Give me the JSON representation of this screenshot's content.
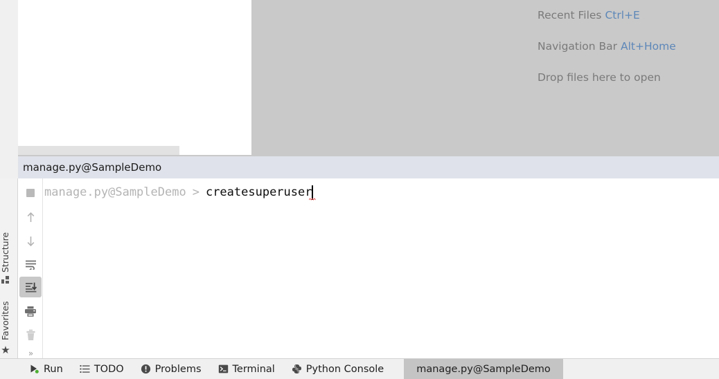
{
  "editor": {
    "hints": [
      {
        "label": "Recent Files",
        "shortcut": "Ctrl+E"
      },
      {
        "label": "Navigation Bar",
        "shortcut": "Alt+Home"
      },
      {
        "label": "Drop files here to open",
        "shortcut": ""
      }
    ]
  },
  "tool_window": {
    "title": "manage.py@SampleDemo",
    "toolbar": [
      {
        "name": "stop-button",
        "tooltip": "Stop"
      },
      {
        "name": "up-button",
        "tooltip": "Up"
      },
      {
        "name": "down-button",
        "tooltip": "Down"
      },
      {
        "name": "soft-wrap-button",
        "tooltip": "Soft-Wrap"
      },
      {
        "name": "scroll-to-end-button",
        "tooltip": "Scroll to the end"
      },
      {
        "name": "print-button",
        "tooltip": "Print"
      },
      {
        "name": "clear-all-button",
        "tooltip": "Clear All"
      },
      {
        "name": "more-button",
        "label": "»"
      }
    ]
  },
  "console": {
    "prompt_prefix": "manage.py@SampleDemo",
    "prompt_arrow": ">",
    "command": "createsuperuser"
  },
  "side_stripe": {
    "structure_label": "Structure",
    "favorites_label": "Favorites",
    "star_glyph": "★"
  },
  "bottom_bar": {
    "items": [
      {
        "label": "Run",
        "icon": "run-icon"
      },
      {
        "label": "TODO",
        "icon": "todo-icon"
      },
      {
        "label": "Problems",
        "icon": "problems-icon"
      },
      {
        "label": "Terminal",
        "icon": "terminal-icon"
      },
      {
        "label": "Python Console",
        "icon": "python-icon"
      },
      {
        "label": "manage.py@SampleDemo",
        "icon": "none"
      }
    ]
  },
  "colors": {
    "editor_bg": "#c9c9c9",
    "hint_text": "#7a7a7a",
    "hint_key": "#5d87b8",
    "tool_window_header": "#dfe2ea",
    "active_tab": "#c4c4c4",
    "prompt_grey": "#b4b4b4",
    "error_squiggle": "#e05252",
    "run_green": "#4caf32"
  }
}
